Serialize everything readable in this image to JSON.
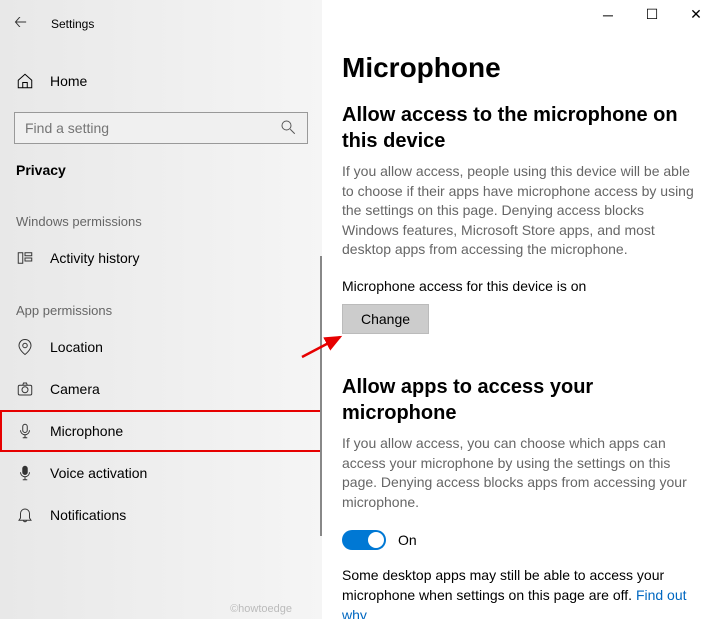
{
  "app": {
    "title": "Settings"
  },
  "sidebar": {
    "home": "Home",
    "searchPlaceholder": "Find a setting",
    "category": "Privacy",
    "sections": {
      "winPerms": "Windows permissions",
      "appPerms": "App permissions"
    },
    "items": {
      "activity": "Activity history",
      "location": "Location",
      "camera": "Camera",
      "microphone": "Microphone",
      "voice": "Voice activation",
      "notifications": "Notifications"
    }
  },
  "content": {
    "pageTitle": "Microphone",
    "section1": {
      "title": "Allow access to the microphone on this device",
      "desc": "If you allow access, people using this device will be able to choose if their apps have microphone access by using the settings on this page. Denying access blocks Windows features, Microsoft Store apps, and most desktop apps from accessing the microphone.",
      "status": "Microphone access for this device is on",
      "button": "Change"
    },
    "section2": {
      "title": "Allow apps to access your microphone",
      "desc": "If you allow access, you can choose which apps can access your microphone by using the settings on this page. Denying access blocks apps from accessing your microphone.",
      "toggleState": "On",
      "note": "Some desktop apps may still be able to access your microphone when settings on this page are off. ",
      "link": "Find out why"
    }
  },
  "watermark": "©howtoedge"
}
